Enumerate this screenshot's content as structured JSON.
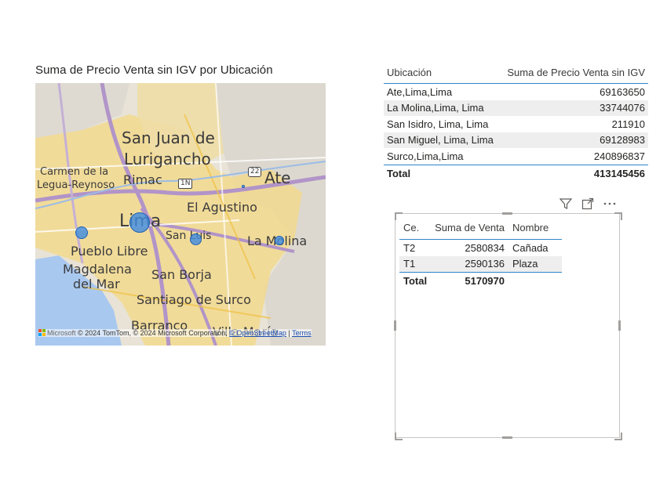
{
  "map_visual": {
    "title": "Suma de Precio Venta sin IGV por Ubicación",
    "places": [
      {
        "name": "San Juan de",
        "size": "big"
      },
      {
        "name": "Lurigancho",
        "size": "big"
      },
      {
        "name": "Carmen de la",
        "size": "sm"
      },
      {
        "name": "Legua-Reynoso",
        "size": "sm"
      },
      {
        "name": "Rimac",
        "size": "med"
      },
      {
        "name": "Ate",
        "size": "big"
      },
      {
        "name": "El Agustino",
        "size": "med"
      },
      {
        "name": "Lima",
        "size": "big"
      },
      {
        "name": "San Luis",
        "size": "sm"
      },
      {
        "name": "La Molina",
        "size": "med"
      },
      {
        "name": "Pueblo Libre",
        "size": "med"
      },
      {
        "name": "Magdalena",
        "size": "med"
      },
      {
        "name": "del Mar",
        "size": "med"
      },
      {
        "name": "San Borja",
        "size": "med"
      },
      {
        "name": "Santiago de Surco",
        "size": "med"
      },
      {
        "name": "Barranco",
        "size": "med"
      },
      {
        "name": "Villa María",
        "size": "med"
      }
    ],
    "road_shields": [
      "1N",
      "22"
    ],
    "attribution": {
      "logo_text": "Microsoft",
      "text": "© 2024 TomTom, © 2024 Microsoft Corporation,",
      "osm_link": "© OpenStreetMap",
      "terms_link": "Terms"
    },
    "bubble_color": "#428cde"
  },
  "table1": {
    "headers": [
      "Ubicación",
      "Suma de Precio Venta sin IGV"
    ],
    "rows": [
      {
        "loc": "Ate,Lima,Lima",
        "value": "69163650"
      },
      {
        "loc": "La Molina,Lima, Lima",
        "value": "33744076"
      },
      {
        "loc": "San Isidro, Lima, Lima",
        "value": "211910"
      },
      {
        "loc": "San Miguel, Lima, Lima",
        "value": "69128983"
      },
      {
        "loc": "Surco,Lima,Lima",
        "value": "240896837"
      }
    ],
    "total_label": "Total",
    "total_value": "413145456"
  },
  "table2": {
    "toolbar": [
      "filter-icon",
      "focus-mode-icon",
      "more-options-icon"
    ],
    "headers": [
      "Ce.",
      "Suma de Venta",
      "Nombre"
    ],
    "rows": [
      {
        "ce": "T2",
        "venta": "2580834",
        "nombre": "Cañada"
      },
      {
        "ce": "T1",
        "venta": "2590136",
        "nombre": "Plaza"
      }
    ],
    "total_label": "Total",
    "total_value": "5170970"
  },
  "colors": {
    "accent": "#2d85c9",
    "water": "#a9c8ef",
    "urban": "#f3d98a",
    "land": "#e9e4d8"
  }
}
